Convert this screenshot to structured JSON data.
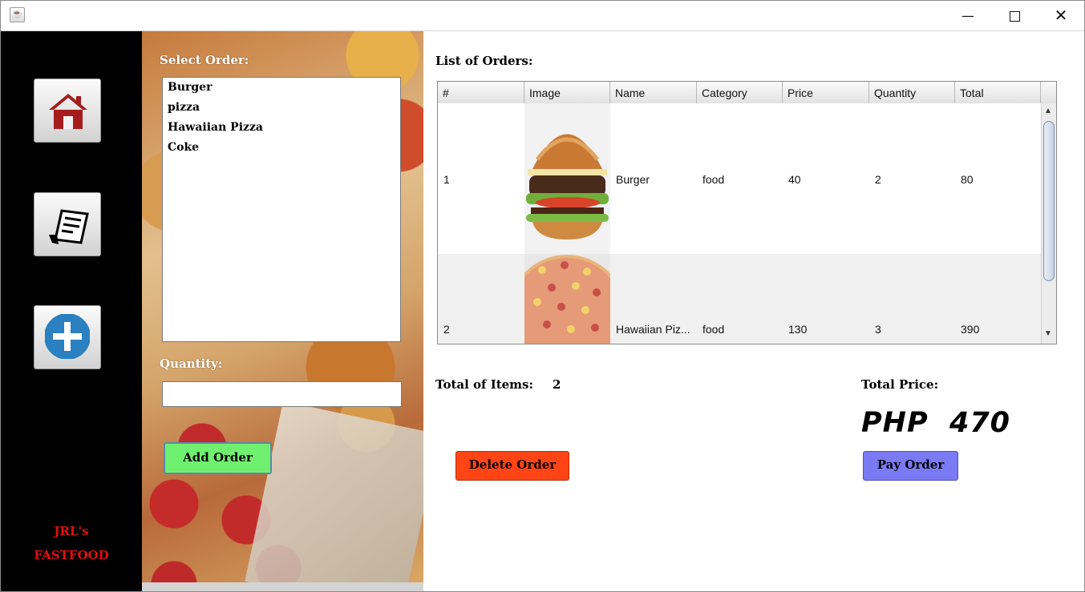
{
  "window": {
    "controls": {
      "minimize": "—",
      "close": "✕"
    }
  },
  "sidebar": {
    "items": [
      {
        "icon": "house-icon"
      },
      {
        "icon": "receipt-icon"
      },
      {
        "icon": "plus-icon"
      }
    ],
    "brand_line1": "JRL's",
    "brand_line2": "FASTFOOD"
  },
  "order_panel": {
    "select_label": "Select Order:",
    "menu_items": [
      "Burger",
      "pizza",
      "Hawaiian Pizza",
      "Coke"
    ],
    "quantity_label": "Quantity:",
    "quantity_value": "",
    "add_button": "Add Order"
  },
  "orders": {
    "title": "List of Orders:",
    "columns": [
      "#",
      "Image",
      "Name",
      "Category",
      "Price",
      "Quantity",
      "Total"
    ],
    "rows": [
      {
        "num": "1",
        "image": "burger-image",
        "name": "Burger",
        "category": "food",
        "price": "40",
        "quantity": "2",
        "total": "80"
      },
      {
        "num": "2",
        "image": "pizza-image",
        "name": "Hawaiian Piz...",
        "category": "food",
        "price": "130",
        "quantity": "3",
        "total": "390"
      }
    ]
  },
  "summary": {
    "total_items_label": "Total of Items:",
    "total_items_value": "2",
    "total_price_label": "Total Price:",
    "total_price_value": "PHP  470",
    "delete_button": "Delete Order",
    "pay_button": "Pay Order"
  },
  "colors": {
    "sidebar_bg": "#000000",
    "brand": "#e01010",
    "add_button": "#6ff06f",
    "delete_button": "#ff4515",
    "pay_button": "#7a7af5"
  }
}
